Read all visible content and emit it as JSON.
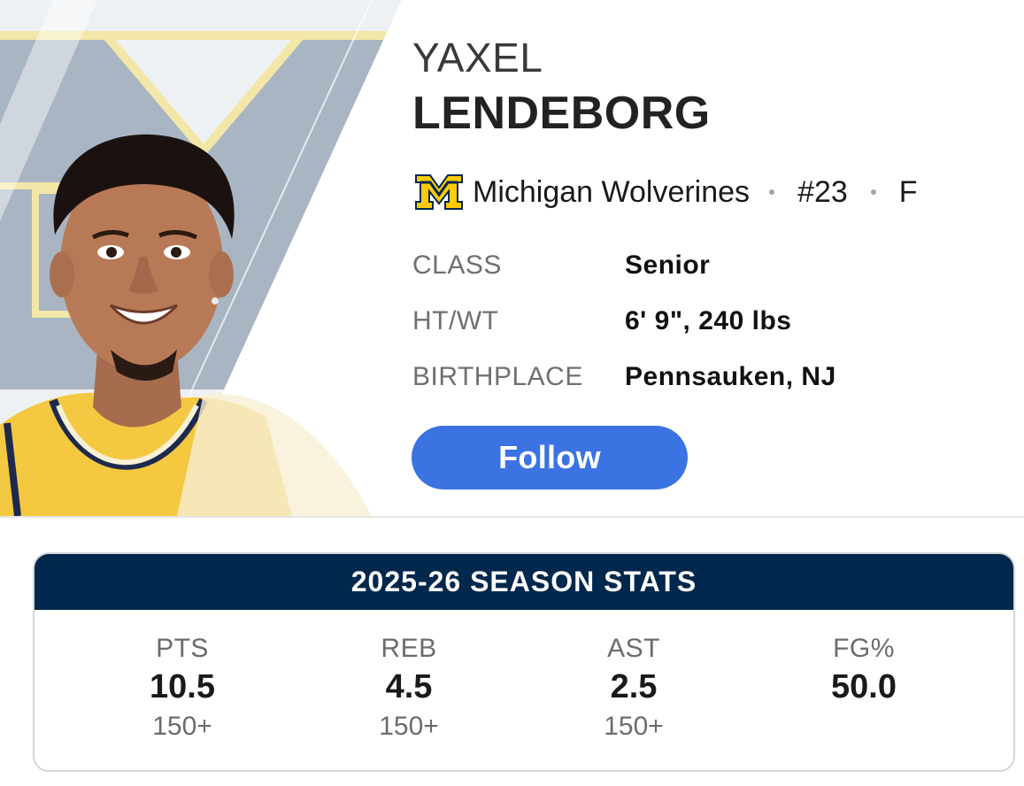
{
  "player": {
    "first_name": "YAXEL",
    "last_name": "LENDEBORG",
    "headshot_icon": "player-headshot",
    "team_logo_icon": "michigan-block-m-logo",
    "team_name": "Michigan Wolverines",
    "jersey_number": "#23",
    "position": "F"
  },
  "bio": [
    {
      "label": "CLASS",
      "value": "Senior"
    },
    {
      "label": "HT/WT",
      "value": "6' 9\", 240 lbs"
    },
    {
      "label": "BIRTHPLACE",
      "value": "Pennsauken, NJ"
    }
  ],
  "follow_button": {
    "label": "Follow"
  },
  "season_stats": {
    "title": "2025-26 SEASON STATS",
    "stats": [
      {
        "label": "PTS",
        "value": "10.5",
        "rank": "150+"
      },
      {
        "label": "REB",
        "value": "4.5",
        "rank": "150+"
      },
      {
        "label": "AST",
        "value": "2.5",
        "rank": "150+"
      },
      {
        "label": "FG%",
        "value": "50.0",
        "rank": ""
      }
    ]
  },
  "colors": {
    "navy": "#00274c",
    "maize": "#ffcb05",
    "follow_blue": "#3c73e2"
  }
}
